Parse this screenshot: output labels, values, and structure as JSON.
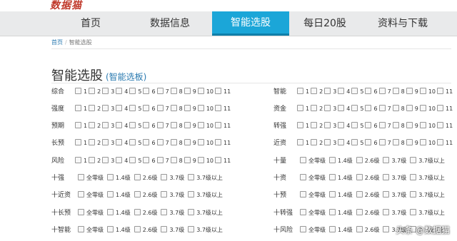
{
  "logo": "数据猫",
  "nav": [
    {
      "label": "首页"
    },
    {
      "label": "数据信息"
    },
    {
      "label": "智能选股"
    },
    {
      "label": "每日20股"
    },
    {
      "label": "资料与下载"
    }
  ],
  "breadcrumb": {
    "home": "首页",
    "sep": "/",
    "current": "智能选股"
  },
  "title": {
    "main": "智能选股",
    "sub": "(智能选板)"
  },
  "num_options": [
    "1",
    "2",
    "3",
    "4",
    "5",
    "6",
    "7",
    "8",
    "9",
    "10",
    "11"
  ],
  "level_options": [
    "全零级",
    "1.4级",
    "2.6级",
    "3.7级",
    "3.7级以上"
  ],
  "left_rows": [
    {
      "label": "综合",
      "type": "num"
    },
    {
      "label": "强度",
      "type": "num"
    },
    {
      "label": "预期",
      "type": "num"
    },
    {
      "label": "长预",
      "type": "num"
    },
    {
      "label": "风险",
      "type": "num"
    },
    {
      "label": "十强",
      "type": "level"
    },
    {
      "label": "十近资",
      "type": "level"
    },
    {
      "label": "十长预",
      "type": "level"
    },
    {
      "label": "十智能",
      "type": "level"
    }
  ],
  "right_rows": [
    {
      "label": "智能",
      "type": "num"
    },
    {
      "label": "资金",
      "type": "num"
    },
    {
      "label": "转强",
      "type": "num"
    },
    {
      "label": "近资",
      "type": "num"
    },
    {
      "label": "十量",
      "type": "level"
    },
    {
      "label": "十资",
      "type": "level"
    },
    {
      "label": "十预",
      "type": "level"
    },
    {
      "label": "十转强",
      "type": "level"
    },
    {
      "label": "十风险",
      "type": "level"
    }
  ],
  "watermark": "头条 @数据猫"
}
